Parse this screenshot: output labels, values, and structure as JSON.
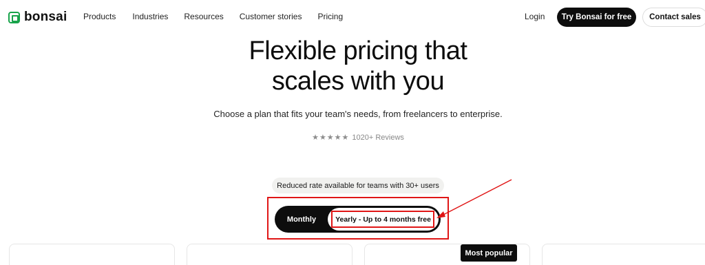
{
  "nav": {
    "logo_text": "bonsai",
    "links": [
      "Products",
      "Industries",
      "Resources",
      "Customer stories",
      "Pricing"
    ],
    "login": "Login",
    "try_button": "Try Bonsai for free",
    "contact_button": "Contact sales"
  },
  "hero": {
    "title_line1": "Flexible pricing that",
    "title_line2": "scales with you",
    "subtitle": "Choose a plan that fits your team's needs, from freelancers to enterprise.",
    "stars": "★★★★★",
    "reviews": "1020+ Reviews"
  },
  "billing": {
    "badge": "Reduced rate available for teams with 30+ users",
    "monthly": "Monthly",
    "yearly": "Yearly - Up to 4 months free"
  },
  "plans": {
    "popular_badge": "Most popular"
  },
  "colors": {
    "brand_green": "#17a34a",
    "dark": "#0d0d0d",
    "annotation_red": "#e01515"
  }
}
